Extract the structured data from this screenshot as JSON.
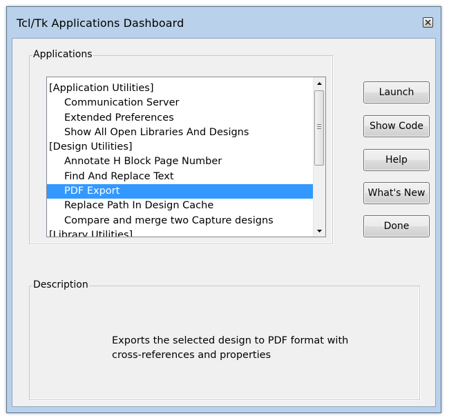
{
  "window": {
    "title": "Tcl/Tk Applications Dashboard"
  },
  "applications": {
    "group_label": "Applications",
    "items": [
      {
        "label": "[Application Utilities]",
        "indent": false,
        "selected": false
      },
      {
        "label": "Communication Server",
        "indent": true,
        "selected": false
      },
      {
        "label": "Extended Preferences",
        "indent": true,
        "selected": false
      },
      {
        "label": "Show All Open Libraries And Designs",
        "indent": true,
        "selected": false
      },
      {
        "label": "[Design Utilities]",
        "indent": false,
        "selected": false
      },
      {
        "label": "Annotate H Block Page Number",
        "indent": true,
        "selected": false
      },
      {
        "label": "Find And Replace Text",
        "indent": true,
        "selected": false
      },
      {
        "label": "PDF Export",
        "indent": true,
        "selected": true
      },
      {
        "label": "Replace Path In Design Cache",
        "indent": true,
        "selected": false
      },
      {
        "label": "Compare and merge two Capture designs",
        "indent": true,
        "selected": false
      },
      {
        "label": "[Library Utilities]",
        "indent": false,
        "selected": false
      }
    ]
  },
  "buttons": {
    "launch": "Launch",
    "show_code": "Show Code",
    "help": "Help",
    "whats_new": "What's New",
    "done": "Done"
  },
  "description": {
    "group_label": "Description",
    "text": "Exports the selected design to PDF format with\ncross-references and properties"
  },
  "colors": {
    "selection": "#3399ff",
    "frame": "#b9d1ea",
    "client": "#f0f0f0"
  }
}
